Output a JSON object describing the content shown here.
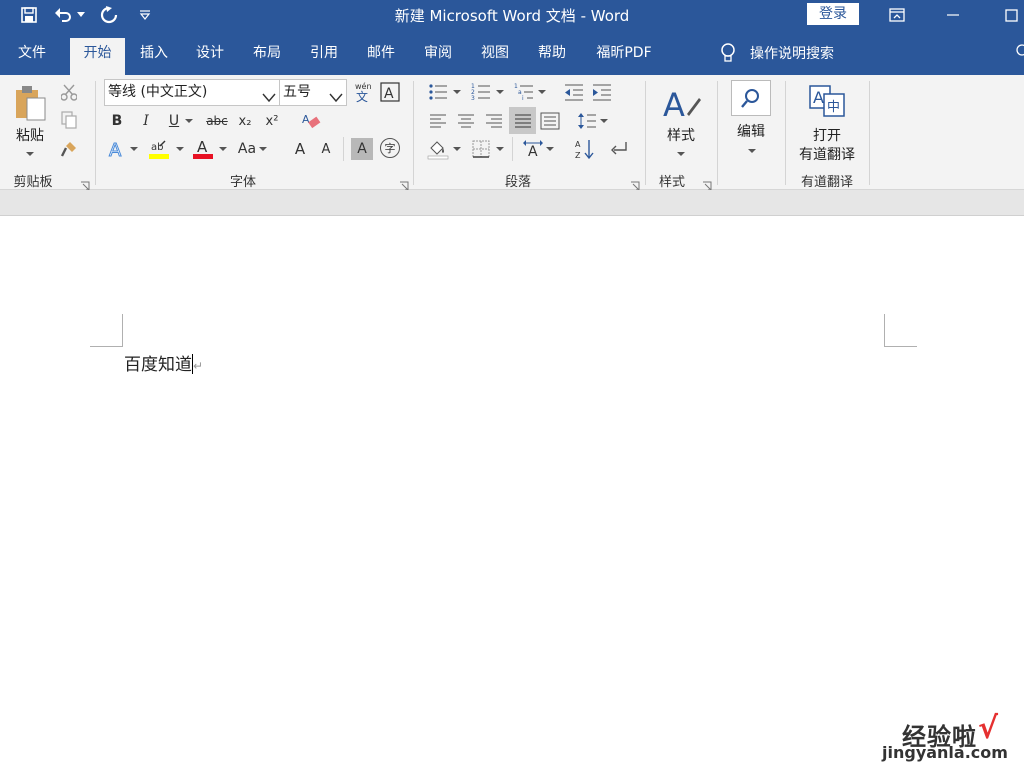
{
  "titlebar": {
    "title": "新建 Microsoft Word 文档  -  Word",
    "login_label": "登录",
    "quick_access": [
      "save-icon",
      "undo-icon",
      "redo-icon",
      "customize-icon"
    ]
  },
  "tabs": {
    "items": [
      "文件",
      "开始",
      "插入",
      "设计",
      "布局",
      "引用",
      "邮件",
      "审阅",
      "视图",
      "帮助",
      "福昕PDF"
    ],
    "active": "开始",
    "search_label": "操作说明搜索"
  },
  "ribbon": {
    "clipboard": {
      "paste_label": "粘贴",
      "group_label": "剪贴板"
    },
    "font": {
      "font_name": "等线 (中文正文)",
      "font_size": "五号",
      "group_label": "字体",
      "bold": "B",
      "italic": "I",
      "underline": "U",
      "strike": "abc",
      "subscript": "x₂",
      "superscript": "x²",
      "grow": "A",
      "shrink": "A",
      "case": "Aa",
      "char_shade": "A",
      "enclose": "字"
    },
    "paragraph": {
      "group_label": "段落"
    },
    "styles": {
      "label": "样式",
      "group_label": "样式"
    },
    "editing": {
      "label": "编辑"
    },
    "youdao": {
      "label_line1": "打开",
      "label_line2": "有道翻译",
      "group_label": "有道翻译"
    }
  },
  "document": {
    "text": "百度知道",
    "paragraph_mark": "↵"
  },
  "watermark": {
    "cn": "经验啦",
    "check": "√",
    "url": "jingyanla.com"
  },
  "colors": {
    "accent": "#2b579a",
    "ribbon_bg": "#f3f3f3",
    "highlight_yellow": "#ffff00",
    "font_red": "#e81123"
  }
}
